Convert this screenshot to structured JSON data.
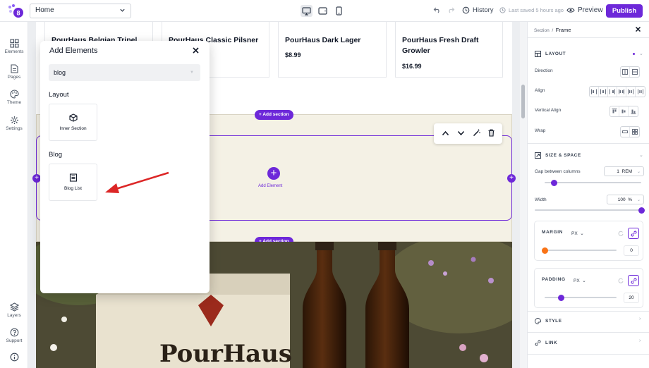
{
  "topbar": {
    "page_selector": "Home",
    "history_label": "History",
    "saved_label": "Last saved 5 hours ago",
    "preview_label": "Preview",
    "publish_label": "Publish"
  },
  "leftnav": {
    "items": [
      {
        "label": "Elements"
      },
      {
        "label": "Pages"
      },
      {
        "label": "Theme"
      },
      {
        "label": "Settings"
      },
      {
        "label": "Layers"
      },
      {
        "label": "Support"
      }
    ]
  },
  "products": [
    {
      "name_line1": "PourHaus Belgian Tripel",
      "name_line2": "",
      "price": ""
    },
    {
      "name_line1": "PourHaus Classic Pilsner",
      "name_line2": "",
      "price": ""
    },
    {
      "name_line1": "PourHaus Dark Lager",
      "name_line2": "",
      "price": "$8.99"
    },
    {
      "name_line1": "PourHaus Fresh Draft",
      "name_line2": "Growler",
      "price": "$16.99"
    }
  ],
  "canvas": {
    "add_section_label": "+ Add section",
    "add_element_label": "Add Element"
  },
  "modal": {
    "title": "Add Elements",
    "search_value": "blog",
    "groups": [
      {
        "label": "Layout",
        "tile": "Inner Section"
      },
      {
        "label": "Blog",
        "tile": "Blog List"
      }
    ]
  },
  "panel": {
    "breadcrumb_parent": "Section",
    "breadcrumb_sep": "/",
    "breadcrumb_current": "Frame",
    "layout_title": "LAYOUT",
    "direction_label": "Direction",
    "align_label": "Align",
    "valign_label": "Vertical Align",
    "wrap_label": "Wrap",
    "size_title": "SIZE & SPACE",
    "gap_label": "Gap between columns",
    "gap_value": "1",
    "gap_unit": "REM",
    "gap_level": 0.1,
    "width_label": "Width",
    "width_value": "100",
    "width_unit": "%",
    "width_level": 1.0,
    "margin_label": "MARGIN",
    "margin_unit": "PX",
    "margin_value": "0",
    "margin_level": 0.0,
    "padding_label": "PADDING",
    "padding_unit": "PX",
    "padding_value": "20",
    "padding_level": 0.23,
    "style_title": "STYLE",
    "link_title": "LINK"
  },
  "colors": {
    "accent": "#6d28d9",
    "margin_thumb": "#f97316",
    "arrow": "#dc2626",
    "section_bg": "#f4f1e5"
  }
}
